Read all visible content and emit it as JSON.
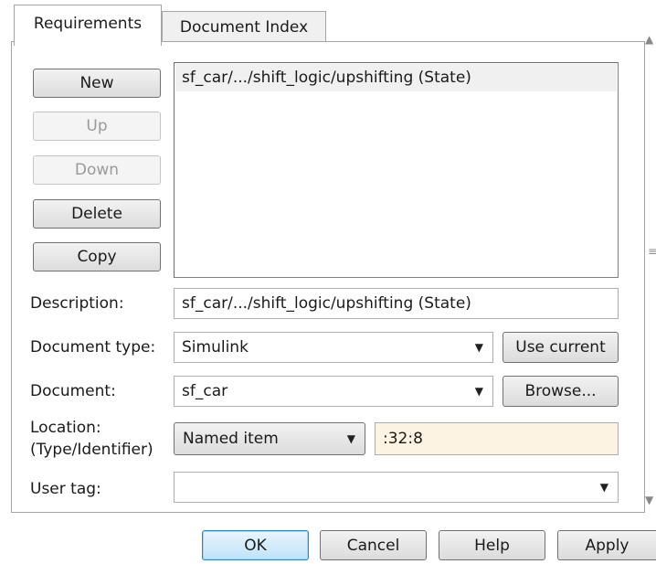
{
  "tabs": [
    {
      "label": "Requirements"
    },
    {
      "label": "Document Index"
    }
  ],
  "side_buttons": {
    "new": "New",
    "up": "Up",
    "down": "Down",
    "delete": "Delete",
    "copy": "Copy"
  },
  "requirements_list": {
    "items": [
      "sf_car/.../shift_logic/upshifting (State)"
    ]
  },
  "form": {
    "description_label": "Description:",
    "description_value": "sf_car/.../shift_logic/upshifting  (State)",
    "doc_type_label": "Document type:",
    "doc_type_value": "Simulink",
    "use_current_label": "Use current",
    "document_label": "Document:",
    "document_value": "sf_car",
    "browse_label": "Browse...",
    "location_label_line1": "Location:",
    "location_label_line2": "(Type/Identifier)",
    "location_type_value": "Named item",
    "location_id_value": ":32:8",
    "user_tag_label": "User tag:",
    "user_tag_value": ""
  },
  "footer": {
    "ok": "OK",
    "cancel": "Cancel",
    "help": "Help",
    "apply": "Apply"
  },
  "colors": {
    "identifier_field_bg": "#fdf3e3",
    "selected_item_bg": "#f0f0f0"
  }
}
